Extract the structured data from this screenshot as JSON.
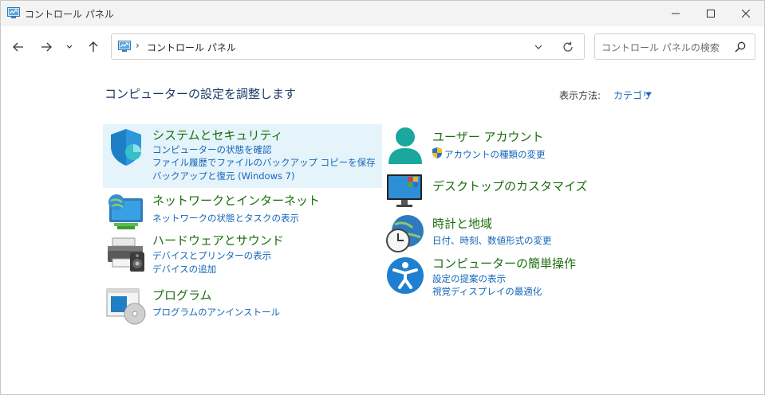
{
  "window": {
    "title": "コントロール パネル"
  },
  "address_bar": {
    "separator": "›",
    "path": "コントロール パネル"
  },
  "search": {
    "placeholder": "コントロール パネルの検索"
  },
  "main": {
    "heading": "コンピューターの設定を調整します",
    "view_by_label": "表示方法:",
    "view_by_value": "カテゴリ"
  },
  "categories": {
    "security": {
      "title": "システムとセキュリティ",
      "links": [
        "コンピューターの状態を確認",
        "ファイル履歴でファイルのバックアップ コピーを保存",
        "バックアップと復元 (Windows 7)"
      ]
    },
    "network": {
      "title": "ネットワークとインターネット",
      "links": [
        "ネットワークの状態とタスクの表示"
      ]
    },
    "hardware": {
      "title": "ハードウェアとサウンド",
      "links": [
        "デバイスとプリンターの表示",
        "デバイスの追加"
      ]
    },
    "programs": {
      "title": "プログラム",
      "links": [
        "プログラムのアンインストール"
      ]
    },
    "users": {
      "title": "ユーザー アカウント",
      "links": [
        "アカウントの種類の変更"
      ]
    },
    "appearance": {
      "title": "デスクトップのカスタマイズ"
    },
    "clock": {
      "title": "時計と地域",
      "links": [
        "日付、時刻、数値形式の変更"
      ]
    },
    "access": {
      "title": "コンピューターの簡単操作",
      "links": [
        "設定の提案の表示",
        "視覚ディスプレイの最適化"
      ]
    }
  }
}
